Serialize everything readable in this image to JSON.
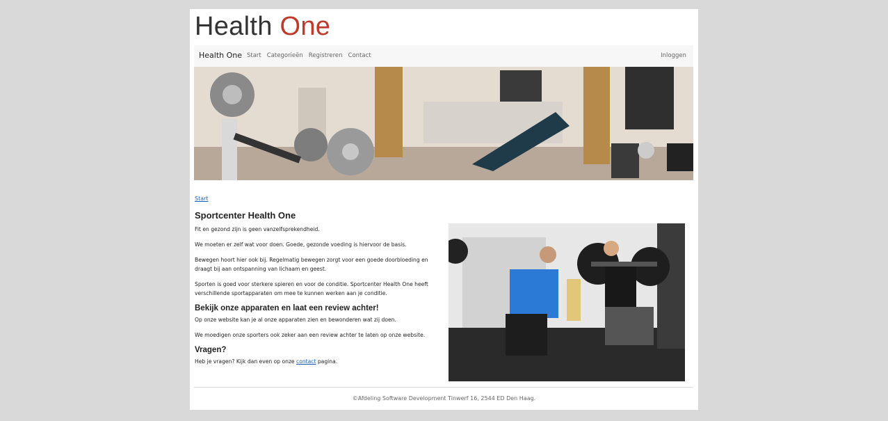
{
  "site": {
    "logo_part1": "Health ",
    "logo_part2": "One",
    "accent_color": "#c0392b"
  },
  "navbar": {
    "brand": "Health One",
    "items": [
      {
        "label": "Start"
      },
      {
        "label": "Categorieën"
      },
      {
        "label": "Registreren"
      },
      {
        "label": "Contact"
      }
    ],
    "login": "Inloggen"
  },
  "hero": {
    "icon": "gym-equipment-banner"
  },
  "breadcrumb": {
    "label": "Start"
  },
  "main": {
    "title": "Sportcenter Health One",
    "p1": "Fit en gezond zijn is geen vanzelfsprekendheid.",
    "p2": "We moeten er zelf wat voor doen. Goede, gezonde voeding is hiervoor de basis.",
    "p3": "Bewegen hoort hier ook bij. Regelmatig bewegen zorgt voor een goede doorbloeding en draagt bij aan ontspanning van lichaam en geest.",
    "p4": "Sporten is goed voor sterkere spieren en voor de conditie. Sportcenter Health One heeft verschillende sportapparaten om mee te kunnen werken aan je conditie.",
    "h2": "Bekijk onze apparaten en laat een review achter!",
    "p5": "Op onze website kan je al onze apparaten zien en bewonderen wat zij doen.",
    "p6": "We moedigen onze sporters ook zeker aan een review achter te laten op onze website.",
    "h3": "Vragen?",
    "p7_before": "Heb je vragen? Kijk dan even op onze ",
    "p7_link": "contact",
    "p7_after": " pagina."
  },
  "photo": {
    "icon": "trainer-photo"
  },
  "footer": {
    "text": "©Afdeling Software Development Tinwerf 16, 2544 ED Den Haag."
  }
}
